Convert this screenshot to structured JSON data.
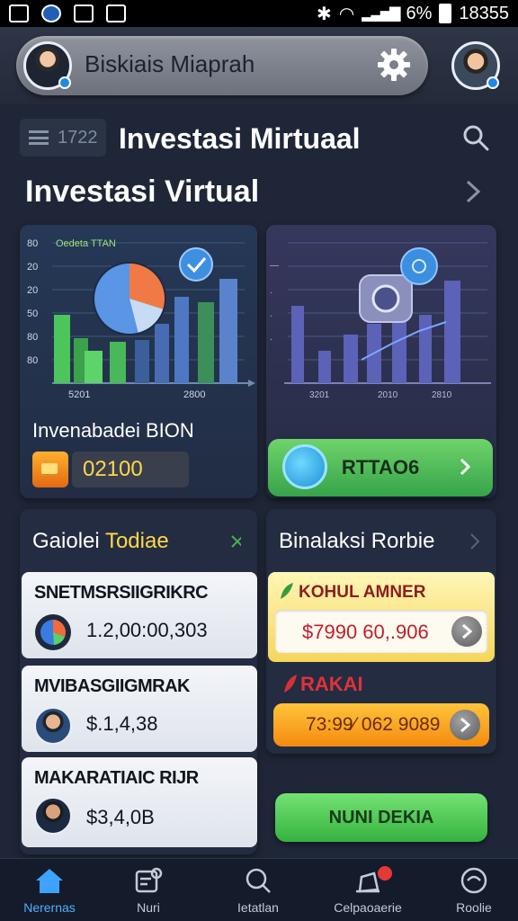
{
  "status_bar": {
    "battery_percent": "6%",
    "time": "18355"
  },
  "header": {
    "profile_name": "Biskiais Miaprah",
    "icons": [
      "gear-icon"
    ]
  },
  "section_bar": {
    "menu_value": "1722",
    "title": "Investasi Mirtuaal"
  },
  "page_title": "Investasi Virtual",
  "chart_left": {
    "legend": "Oedeta TTAN",
    "y_ticks": [
      "80",
      "20",
      "20",
      "50",
      "80",
      "80",
      "80"
    ],
    "x_ticks": [
      "5201",
      "2800"
    ],
    "card_label": "Invenabadei BION",
    "value": "02100"
  },
  "chart_right": {
    "x_ticks": [
      "3201",
      "2010",
      "2810"
    ],
    "button_label": "RTTAO6"
  },
  "panel_left": {
    "title_part1": "Gaiolei ",
    "title_part2": "Todiae",
    "items": [
      {
        "label": "SNETMSRSIIGRIKRC",
        "value": "1.2,00:00,303"
      },
      {
        "label": "MVIBASGIIGMRAK",
        "value": "$.1,4,38"
      },
      {
        "label": "MAKARATIAIC RIJR",
        "value": "$3,4,0B"
      }
    ]
  },
  "panel_right": {
    "title": "Binalaksi Rorbie",
    "yellow_label": "KOHUL AMNER",
    "yellow_value": "$7990 60,.906",
    "red_label": "RAKAI",
    "orange_value": "73:99⁄ 062 9089",
    "cta_label": "NUNI DEKIA"
  },
  "bottom_nav": [
    {
      "label": "Nerernas",
      "icon": "home-icon",
      "active": true
    },
    {
      "label": "Nuri",
      "icon": "cards-icon",
      "active": false
    },
    {
      "label": "Ietatlan",
      "icon": "search-icon",
      "active": false
    },
    {
      "label": "Celpaoaerie",
      "icon": "notification-icon",
      "active": false
    },
    {
      "label": "Roolie",
      "icon": "profile-icon",
      "active": false
    }
  ],
  "colors": {
    "background": "#1f2637",
    "accent_yellow": "#ffd84a",
    "accent_green": "#4caf50",
    "accent_blue": "#4fb0ff"
  }
}
